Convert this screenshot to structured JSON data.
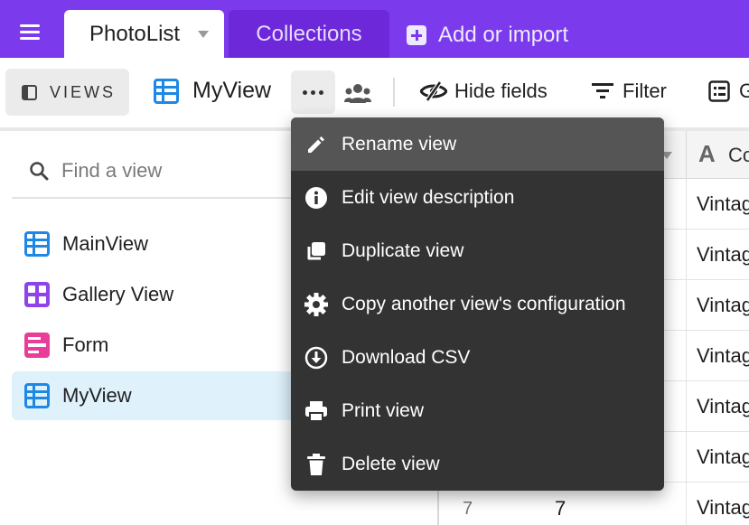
{
  "topbar": {
    "active_tab": "PhotoList",
    "inactive_tab": "Collections",
    "add_import_label": "Add or import",
    "accent_color": "#7c3aed"
  },
  "toolbar": {
    "views_label": "VIEWS",
    "current_view": "MyView",
    "hide_fields_label": "Hide fields",
    "filter_label": "Filter",
    "group_label": "G"
  },
  "sidebar": {
    "search_placeholder": "Find a view",
    "items": [
      {
        "label": "MainView",
        "icon": "grid-view-icon",
        "color": "#1e88e5"
      },
      {
        "label": "Gallery View",
        "icon": "gallery-view-icon",
        "color": "#8e44e8"
      },
      {
        "label": "Form",
        "icon": "form-view-icon",
        "color": "#e83e9a"
      },
      {
        "label": "MyView",
        "icon": "grid-view-icon",
        "color": "#1e88e5",
        "selected": true
      }
    ]
  },
  "grid": {
    "column_header": "Co",
    "rows": [
      {
        "cell": "Vintag"
      },
      {
        "cell": "Vintag"
      },
      {
        "cell": "Vintag"
      },
      {
        "cell": "Vintag"
      },
      {
        "cell": "Vintag"
      },
      {
        "cell": "Vintag"
      },
      {
        "cell": "Vintag",
        "row_number": "7",
        "id": "7"
      }
    ]
  },
  "menu": {
    "items": [
      {
        "label": "Rename view",
        "icon": "pencil-icon"
      },
      {
        "label": "Edit view description",
        "icon": "info-icon"
      },
      {
        "label": "Duplicate view",
        "icon": "duplicate-icon"
      },
      {
        "label": "Copy another view's configuration",
        "icon": "gear-icon"
      },
      {
        "label": "Download CSV",
        "icon": "download-icon"
      },
      {
        "label": "Print view",
        "icon": "print-icon"
      },
      {
        "label": "Delete view",
        "icon": "trash-icon"
      }
    ]
  }
}
